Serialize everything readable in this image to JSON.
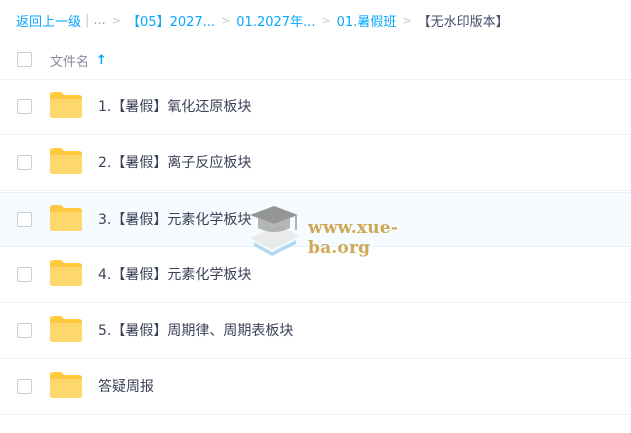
{
  "breadcrumb": {
    "back": "返回上一级",
    "ellipsis": "...",
    "items": [
      "【05】2027...",
      "01.2027年...",
      "01.暑假班"
    ],
    "current": "【无水印版本】"
  },
  "header": {
    "column_name": "文件名",
    "sort_icon": "arrow-up-icon"
  },
  "files": [
    {
      "name": "1.【暑假】氧化还原板块",
      "icon": "folder-icon"
    },
    {
      "name": "2.【暑假】离子反应板块",
      "icon": "folder-icon"
    },
    {
      "name": "3.【暑假】元素化学板块",
      "icon": "folder-icon"
    },
    {
      "name": "4.【暑假】元素化学板块",
      "icon": "folder-icon"
    },
    {
      "name": "5.【暑假】周期律、周期表板块",
      "icon": "folder-icon"
    },
    {
      "name": "答疑周报",
      "icon": "folder-icon"
    }
  ],
  "watermark": {
    "text": "www.xue-ba.org"
  },
  "colors": {
    "accent": "#06a7ff",
    "folder": "#ffd255",
    "highlight_row": "#f5fbff",
    "watermark": "#c99a3a"
  }
}
